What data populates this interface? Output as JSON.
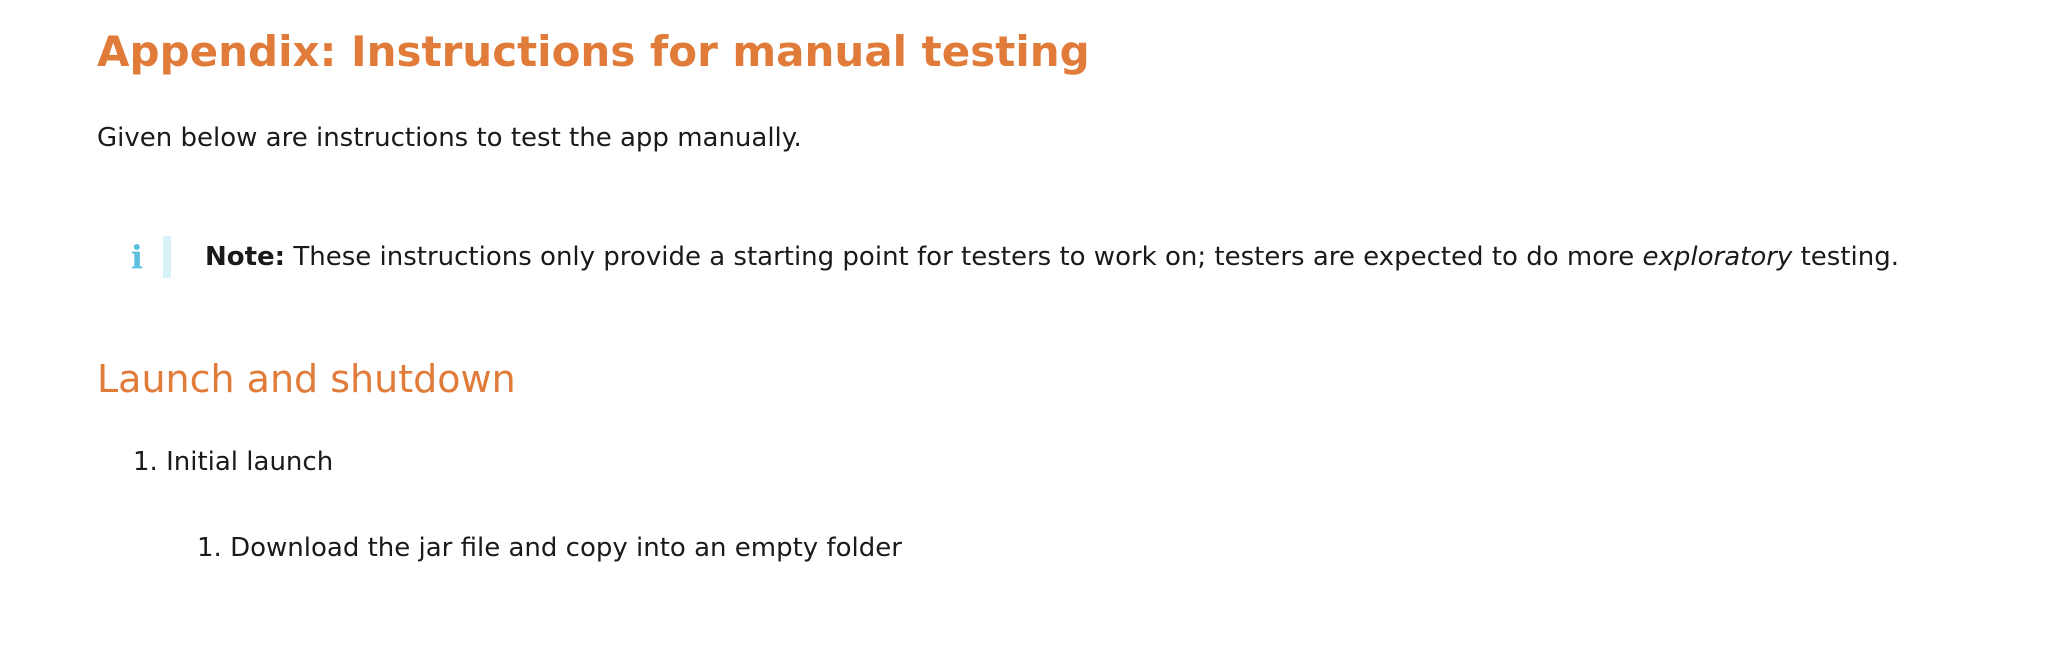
{
  "title": "Appendix: Instructions for manual testing",
  "intro": "Given below are instructions to test the app manually.",
  "note": {
    "icon": "info-icon",
    "label": "Note:",
    "text_before": " These instructions only provide a starting point for testers to work on; testers are expected to do more ",
    "emphasis": "exploratory",
    "text_after": " testing."
  },
  "section": {
    "heading": "Launch and shutdown",
    "steps": [
      {
        "number": "1.",
        "label": "Initial launch",
        "substeps": [
          {
            "number": "1.",
            "label": "Download the jar file and copy into an empty folder"
          }
        ]
      }
    ]
  },
  "colors": {
    "heading": "#e07b39",
    "info_icon": "#5bc0de",
    "info_bar": "#d9f1f8"
  }
}
